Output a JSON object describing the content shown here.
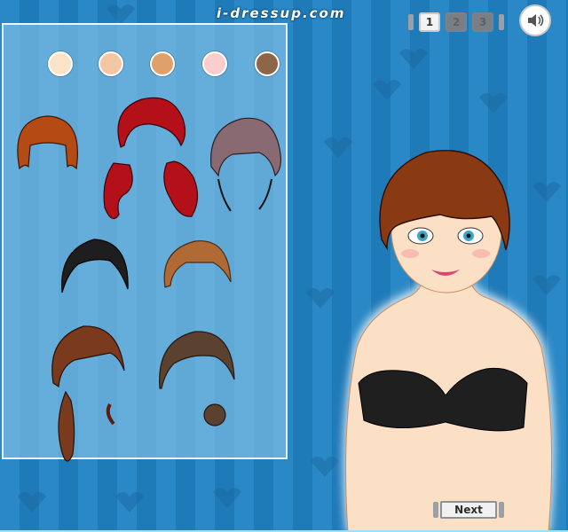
{
  "header": {
    "logo_text": "i-dressup.com",
    "pages": [
      {
        "label": "1",
        "active": true
      },
      {
        "label": "2",
        "active": false
      },
      {
        "label": "3",
        "active": false
      }
    ],
    "sound_icon": "speaker-icon"
  },
  "skin_tones": [
    "#fbe3c8",
    "#f3c7a3",
    "#e0a06a",
    "#fbcdcc",
    "#8d6649"
  ],
  "hair_options": [
    {
      "name": "auburn-bob",
      "color": "#b44a14"
    },
    {
      "name": "red-long-wavy",
      "color": "#b3101a"
    },
    {
      "name": "mauve-long",
      "color": "#8a6a72"
    },
    {
      "name": "black-short",
      "color": "#1e1e1e"
    },
    {
      "name": "copper-updo",
      "color": "#b06a35"
    },
    {
      "name": "brown-ponytail",
      "color": "#7a3a1e"
    },
    {
      "name": "brown-side-bun",
      "color": "#5a4130"
    }
  ],
  "model": {
    "hair_color": "#8a3a12",
    "top_color": "#1f1f1f",
    "skin_color": "#fbe0c6"
  },
  "footer": {
    "next_label": "Next"
  }
}
